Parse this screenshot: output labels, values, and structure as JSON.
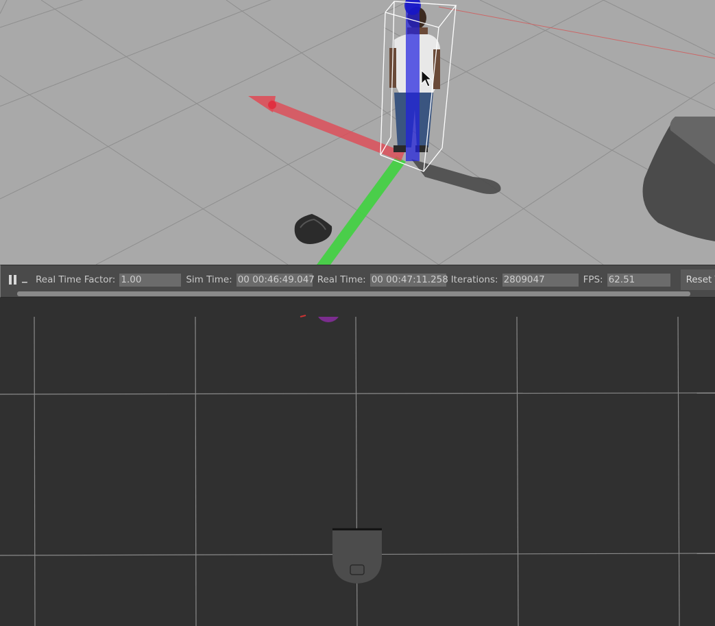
{
  "time_panel": {
    "pause_icon": "pause-icon",
    "step_icon": "step-icon",
    "real_time_factor_label": "Real Time Factor:",
    "real_time_factor_value": "1.00",
    "sim_time_label": "Sim Time:",
    "sim_time_value": "00 00:46:49.047",
    "real_time_label": "Real Time:",
    "real_time_value": "00 00:47:11.258",
    "iterations_label": "Iterations:",
    "iterations_value": "2809047",
    "fps_label": "FPS:",
    "fps_value": "62.51",
    "reset_label": "Reset Tir"
  },
  "colors": {
    "ground_plane": "#a9a9a9",
    "x_axis": "#e0404a",
    "y_axis": "#3ed83e",
    "z_axis": "#2323e0",
    "panel_bg": "#4a4a4a",
    "rviz_bg": "#303030"
  }
}
